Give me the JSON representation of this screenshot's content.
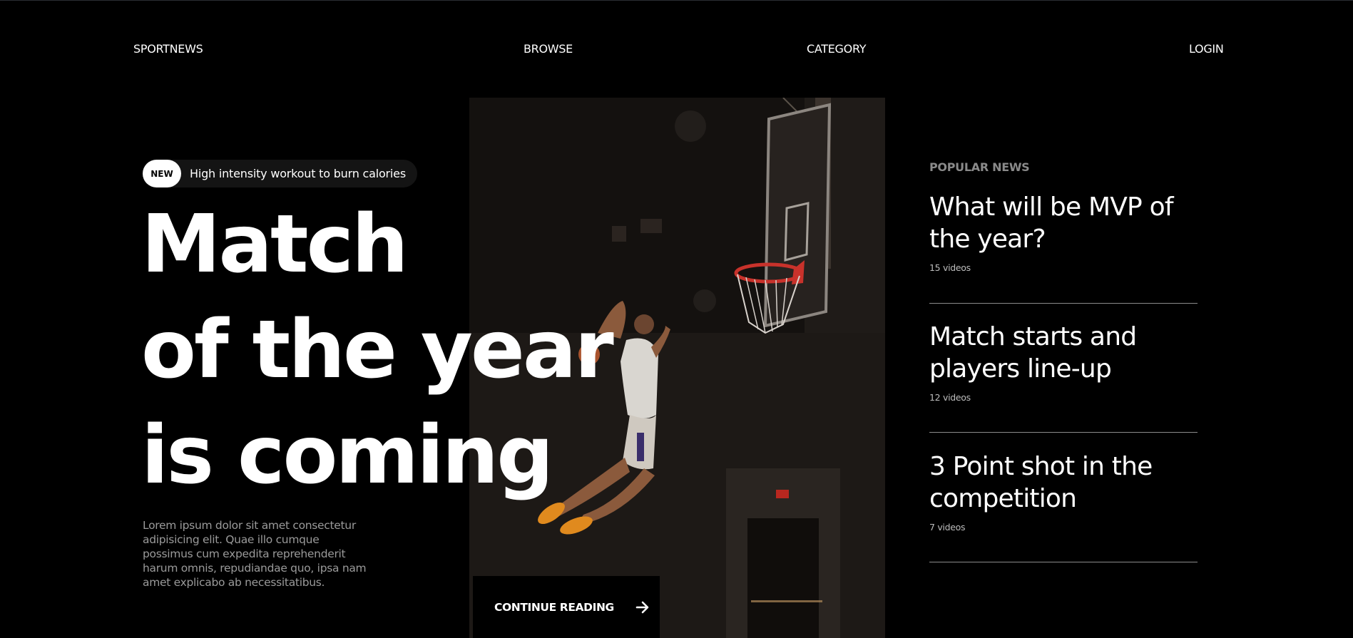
{
  "nav": {
    "logo": "SPORTNEWS",
    "browse": "BROWSE",
    "category": "CATEGORY",
    "login": "LOGIN"
  },
  "badge": {
    "tag": "NEW",
    "text": "High intensity workout to burn calories"
  },
  "hero": {
    "headline_lines": [
      "Match",
      "of the year",
      "is coming"
    ],
    "lead": "Lorem ipsum dolor sit amet consectetur adipisicing elit. Quae illo cumque possimus cum expedita reprehenderit harum omnis, repudiandae quo, ipsa nam amet explicabo ab necessitatibus.",
    "cta_label": "CONTINUE READING",
    "image_icon": "basketball-dunk-photo"
  },
  "popular": {
    "title": "POPULAR NEWS",
    "items": [
      {
        "title": "What will be MVP of the year?",
        "count": "15 videos"
      },
      {
        "title": "Match starts and players line-up",
        "count": "12 videos"
      },
      {
        "title": "3 Point shot in the competition",
        "count": "7 videos"
      }
    ]
  },
  "colors": {
    "background": "#000000",
    "text": "#ffffff",
    "muted": "#9a9a9a",
    "rim": "#c8322b",
    "shoes": "#e08a1e"
  }
}
